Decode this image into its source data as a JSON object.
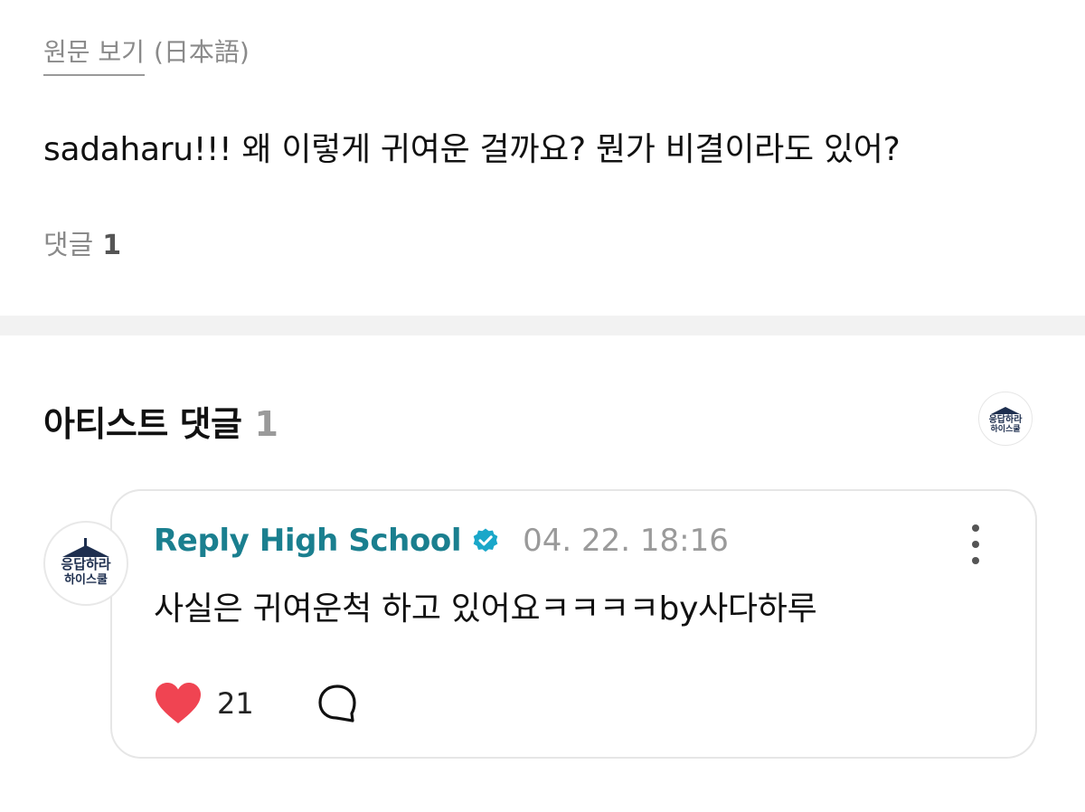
{
  "post": {
    "view_original": "원문 보기",
    "language": "(日本語)",
    "text": "sadaharu!!! 왜 이렇게 귀여운 걸까요? 뭔가 비결이라도 있어?",
    "comments_label": "댓글",
    "comments_count": "1"
  },
  "artist_comments": {
    "title": "아티스트 댓글",
    "count": "1",
    "avatar_icon": "reply-high-school-logo",
    "avatar_logo_line1": "응답하라",
    "avatar_logo_line2": "하이스쿨"
  },
  "reply": {
    "author": "Reply High School",
    "verified_icon": "verified-badge-icon",
    "timestamp": "04. 22. 18:16",
    "text": "사실은 귀여운척 하고 있어요ㅋㅋㅋㅋby사다하루",
    "likes": "21",
    "like_icon": "heart-icon",
    "reply_icon": "speech-bubble-icon",
    "more_icon": "more-vertical-icon"
  },
  "colors": {
    "author": "#1a7f8f",
    "verified": "#1aa7c9",
    "heart": "#f04452",
    "muted": "#8a8a8a",
    "divider": "#f2f2f2"
  }
}
